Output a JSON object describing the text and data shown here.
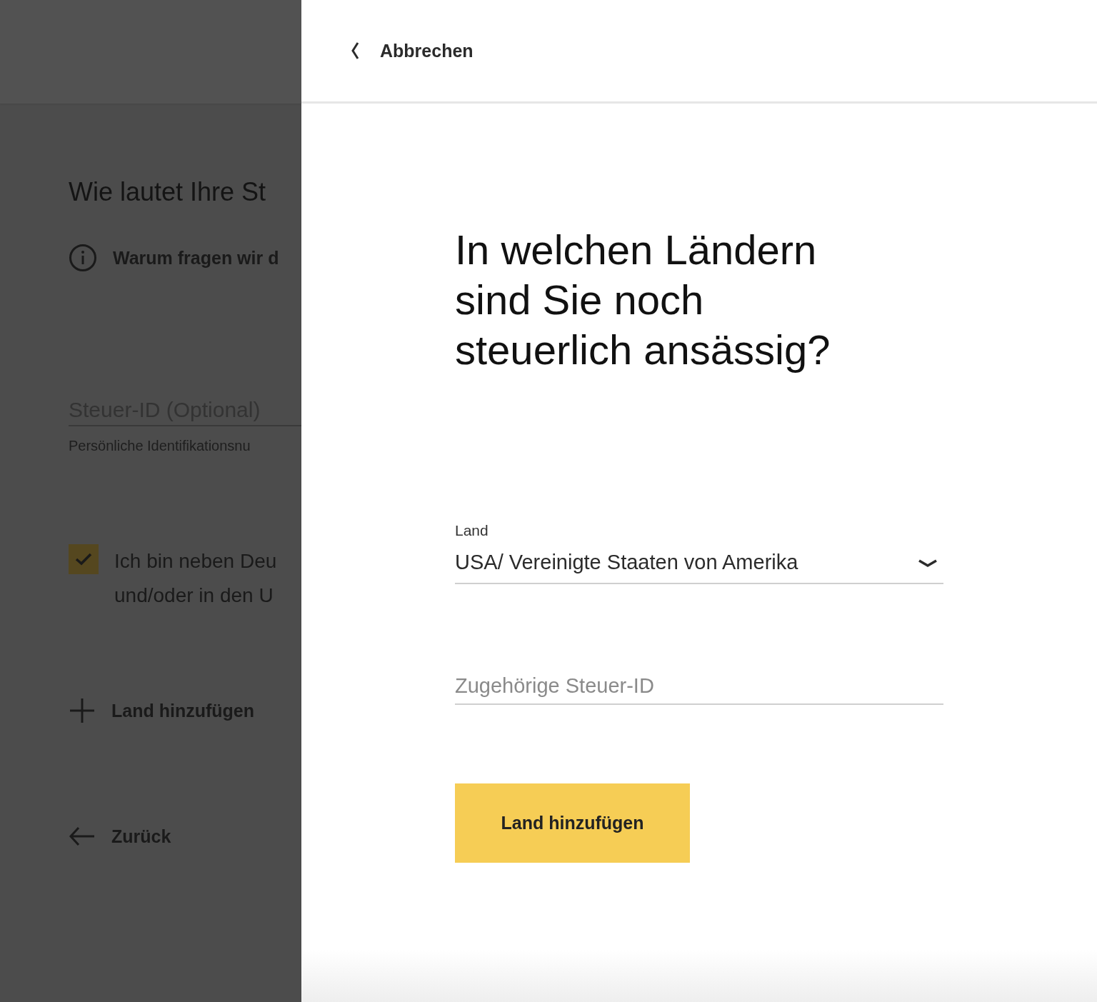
{
  "background_page": {
    "title": "Wie lautet Ihre St",
    "info_link": "Warum fragen wir d",
    "tax_id_field": {
      "placeholder": "Steuer-ID (Optional)",
      "hint": "Persönliche Identifikationsnu"
    },
    "checkbox": {
      "checked": true,
      "label_lines": [
        "Ich bin neben Deu",
        "und/oder in den U"
      ]
    },
    "add_country_link": "Land hinzufügen",
    "back_link": "Zurück"
  },
  "panel": {
    "cancel_link": "Abbrechen",
    "heading": "In welchen Ländern sind Sie noch steuerlich ansässig?",
    "country_select": {
      "label": "Land",
      "value": "USA/ Vereinigte Staaten von Amerika"
    },
    "tax_id_field": {
      "placeholder": "Zugehörige Steuer-ID"
    },
    "submit_button": "Land hinzufügen"
  }
}
